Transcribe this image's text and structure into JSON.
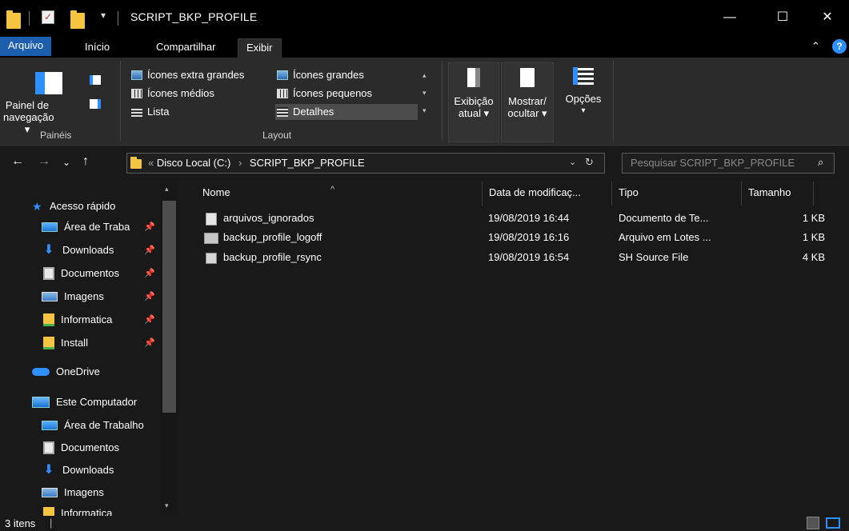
{
  "window": {
    "title": "SCRIPT_BKP_PROFILE",
    "minimize": "—",
    "maximize": "☐",
    "close": "✕"
  },
  "ribbon_tabs": [
    "Arquivo",
    "Início",
    "Compartilhar",
    "Exibir"
  ],
  "ribbon": {
    "paineis": {
      "nav_pane_label_line1": "Painel de",
      "nav_pane_label_line2": "navegação ▾",
      "group_label": "Painéis"
    },
    "layout": {
      "items": [
        "Ícones extra grandes",
        "Ícones grandes",
        "Ícones médios",
        "Ícones pequenos",
        "Lista",
        "Detalhes"
      ],
      "selected": "Detalhes",
      "group_label": "Layout"
    },
    "current_view": {
      "exibicao_line1": "Exibição",
      "exibicao_line2": "atual ▾",
      "mostrar_line1": "Mostrar/",
      "mostrar_line2": "ocultar ▾",
      "opcoes": "Opções"
    }
  },
  "address": {
    "prefix": "«",
    "path": [
      "Disco Local (C:)",
      "SCRIPT_BKP_PROFILE"
    ],
    "separator": "›",
    "search_placeholder": "Pesquisar SCRIPT_BKP_PROFILE"
  },
  "navigation": {
    "quick_access": "Acesso rápido",
    "pinned": [
      {
        "label": "Área de Traba",
        "icon": "desktop-icon"
      },
      {
        "label": "Downloads",
        "icon": "download-icon"
      },
      {
        "label": "Documentos",
        "icon": "documents-icon"
      },
      {
        "label": "Imagens",
        "icon": "pictures-icon"
      },
      {
        "label": "Informatica",
        "icon": "folder-icon"
      },
      {
        "label": "Install",
        "icon": "folder-icon"
      }
    ],
    "onedrive": "OneDrive",
    "this_pc": "Este Computador",
    "pc_items": [
      {
        "label": "Área de Trabalho",
        "icon": "desktop-icon"
      },
      {
        "label": "Documentos",
        "icon": "documents-icon"
      },
      {
        "label": "Downloads",
        "icon": "download-icon"
      },
      {
        "label": "Imagens",
        "icon": "pictures-icon"
      },
      {
        "label": "Informatica",
        "icon": "folder-icon"
      }
    ]
  },
  "columns": [
    "Nome",
    "Data de modificaç...",
    "Tipo",
    "Tamanho"
  ],
  "files": [
    {
      "name": "arquivos_ignorados",
      "date": "19/08/2019 16:44",
      "type": "Documento de Te...",
      "size": "1 KB",
      "icon": "text-file-icon"
    },
    {
      "name": "backup_profile_logoff",
      "date": "19/08/2019 16:16",
      "type": "Arquivo em Lotes ...",
      "size": "1 KB",
      "icon": "batch-file-icon"
    },
    {
      "name": "backup_profile_rsync",
      "date": "19/08/2019 16:54",
      "type": "SH Source File",
      "size": "4 KB",
      "icon": "sh-file-icon"
    }
  ],
  "status": {
    "item_count": "3 itens"
  },
  "colors": {
    "file_tab": "#1b5fae",
    "accent": "#2e8fff",
    "background": "#191919",
    "ribbon": "#2b2b2b"
  }
}
